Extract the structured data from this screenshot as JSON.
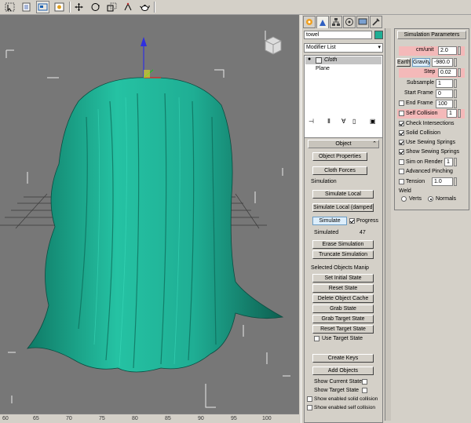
{
  "toolbar": {
    "icons": [
      "select-icon",
      "select-by-name-icon",
      "region-icon",
      "window-crossing-icon",
      "move-icon",
      "rotate-icon",
      "scale-icon",
      "teapot-icon"
    ]
  },
  "viewport": {
    "ruler_labels": [
      "60",
      "65",
      "70",
      "75",
      "80",
      "85",
      "90",
      "95",
      "100"
    ],
    "cloth_color": "#1fae94"
  },
  "command_panel": {
    "tabs": [
      "create-tab-icon",
      "modify-tab-icon",
      "hierarchy-tab-icon",
      "motion-tab-icon",
      "display-tab-icon",
      "utilities-tab-icon"
    ],
    "object_name": "towel",
    "object_color": "#1fae94",
    "modifier_list": "Modifier List",
    "stack": [
      {
        "label": "Cloth",
        "selected": true
      },
      {
        "label": "Plane",
        "selected": false
      }
    ],
    "object_rollout": {
      "title": "Object",
      "object_properties": "Object Properties",
      "cloth_forces": "Cloth Forces",
      "simulation_label": "Simulation",
      "simulate_local": "Simulate Local",
      "simulate_local_damped": "Simulate Local (damped)",
      "simulate": "Simulate",
      "progress": "Progress",
      "simulated_label": "Simulated",
      "simulated_value": "47",
      "erase_simulation": "Erase Simulation",
      "truncate_simulation": "Truncate Simulation",
      "selected_objects_label": "Selected Objects Manip",
      "set_initial_state": "Set Initial State",
      "reset_state": "Reset State",
      "delete_object_cache": "Delete Object Cache",
      "grab_state": "Grab State",
      "grab_target_state": "Grab Target State",
      "reset_target_state": "Reset Target State",
      "use_target_state": "Use Target State",
      "create_keys": "Create Keys",
      "add_objects": "Add Objects",
      "show_current_state": "Show Current State",
      "show_target_state": "Show Target State",
      "show_enabled_solid": "Show enabled solid collision",
      "show_enabled_self": "Show enabled self collision"
    }
  },
  "sim_params": {
    "title": "Simulation Parameters",
    "cm_unit_label": "cm/unit",
    "cm_unit_value": "2.0",
    "earth_label": "Earth",
    "gravity_label": "Gravity",
    "gravity_value": "-980.0",
    "step_label": "Step",
    "step_value": "0.02",
    "subsample_label": "Subsample",
    "subsample_value": "1",
    "start_frame_label": "Start Frame",
    "start_frame_value": "0",
    "end_frame_label": "End Frame",
    "end_frame_value": "100",
    "self_collision_label": "Self Collision",
    "self_collision_value": "1",
    "check_intersections": "Check Intersections",
    "solid_collision": "Solid Collision",
    "use_sewing_springs": "Use Sewing Springs",
    "show_sewing_springs": "Show Sewing Springs",
    "sim_on_render": "Sim on Render",
    "sim_on_render_value": "1",
    "advanced_pinching": "Advanced Pinching",
    "tension_label": "Tension",
    "tension_value": "1.0",
    "weld_label": "Weld",
    "verts_label": "Verts",
    "normals_label": "Normals",
    "highlight_color": "#f4b9b9"
  }
}
